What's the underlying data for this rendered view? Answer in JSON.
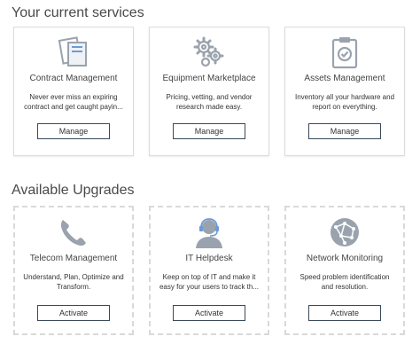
{
  "current_services": {
    "heading": "Your current services",
    "cards": [
      {
        "title": "Contract Management",
        "description": "Never ever miss an expiring contract and get caught payin...",
        "button": "Manage",
        "icon": "documents-icon"
      },
      {
        "title": "Equipment Marketplace",
        "description": "Pricing, vetting, and vendor research made easy.",
        "button": "Manage",
        "icon": "gears-icon"
      },
      {
        "title": "Assets Management",
        "description": "Inventory all your hardware and report on everything.",
        "button": "Manage",
        "icon": "clipboard-check-icon"
      }
    ]
  },
  "available_upgrades": {
    "heading": "Available Upgrades",
    "cards": [
      {
        "title": "Telecom Management",
        "description": "Understand, Plan, Optimize and Transform.",
        "button": "Activate",
        "icon": "phone-handset-icon"
      },
      {
        "title": "IT Helpdesk",
        "description": "Keep on top of IT and make it easy for your users to track th...",
        "button": "Activate",
        "icon": "headset-agent-icon"
      },
      {
        "title": "Network Monitoring",
        "description": "Speed problem identification and resolution.",
        "button": "Activate",
        "icon": "network-globe-icon"
      }
    ]
  },
  "colors": {
    "icon_gray": "#9aa3ad",
    "icon_blue": "#6a9bd8",
    "button_border": "#3a4a5a",
    "card_border": "#dcdcdc"
  }
}
